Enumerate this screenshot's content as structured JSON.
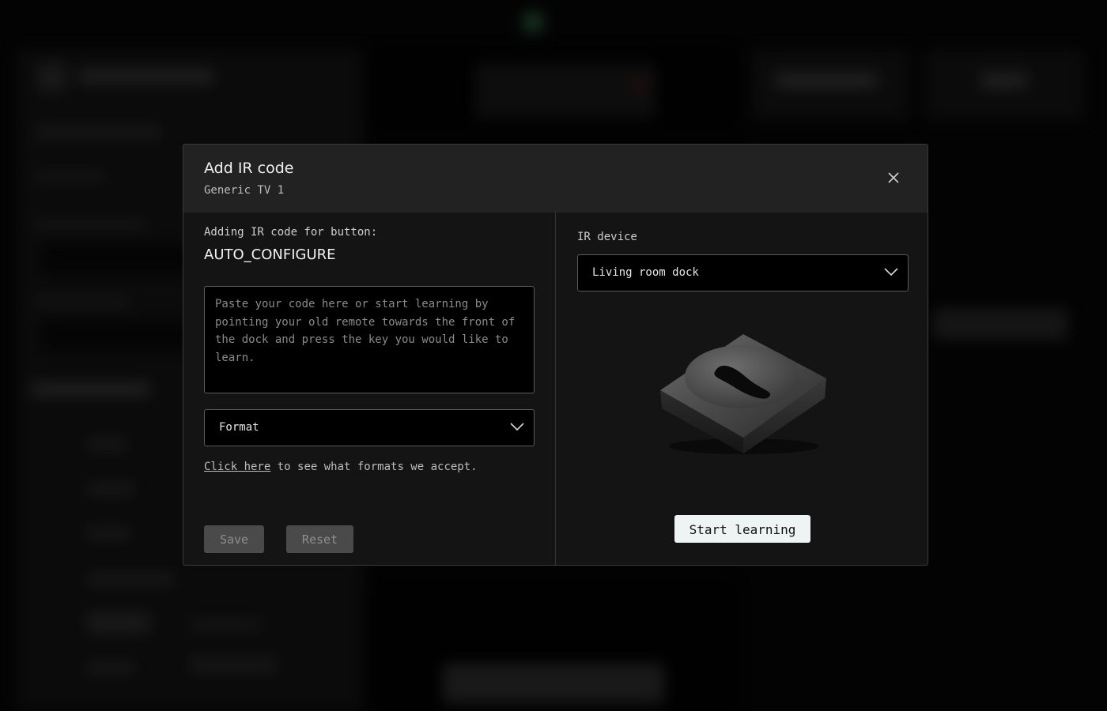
{
  "modal": {
    "title": "Add IR code",
    "subtitle": "Generic TV 1",
    "close_icon": "close-icon"
  },
  "left": {
    "adding_label": "Adding IR code for button:",
    "button_name": "AUTO_CONFIGURE",
    "code_placeholder": "Paste your code here or start learning by pointing your old remote towards the front of the dock and press the key you would like to learn.",
    "code_value": "",
    "format_label": "Format",
    "formats_link": "Click here",
    "formats_note": " to see what formats we accept.",
    "save_label": "Save",
    "reset_label": "Reset"
  },
  "right": {
    "ir_device_label": "IR device",
    "ir_device_value": "Living room dock",
    "dock_image_icon": "dock-image",
    "learn_label": "Start learning"
  },
  "colors": {
    "modal_bg": "#141414",
    "header_bg": "#222222",
    "input_bg": "#000000",
    "disabled_button": "#4a4a4a",
    "primary_button": "#eef3f3"
  }
}
